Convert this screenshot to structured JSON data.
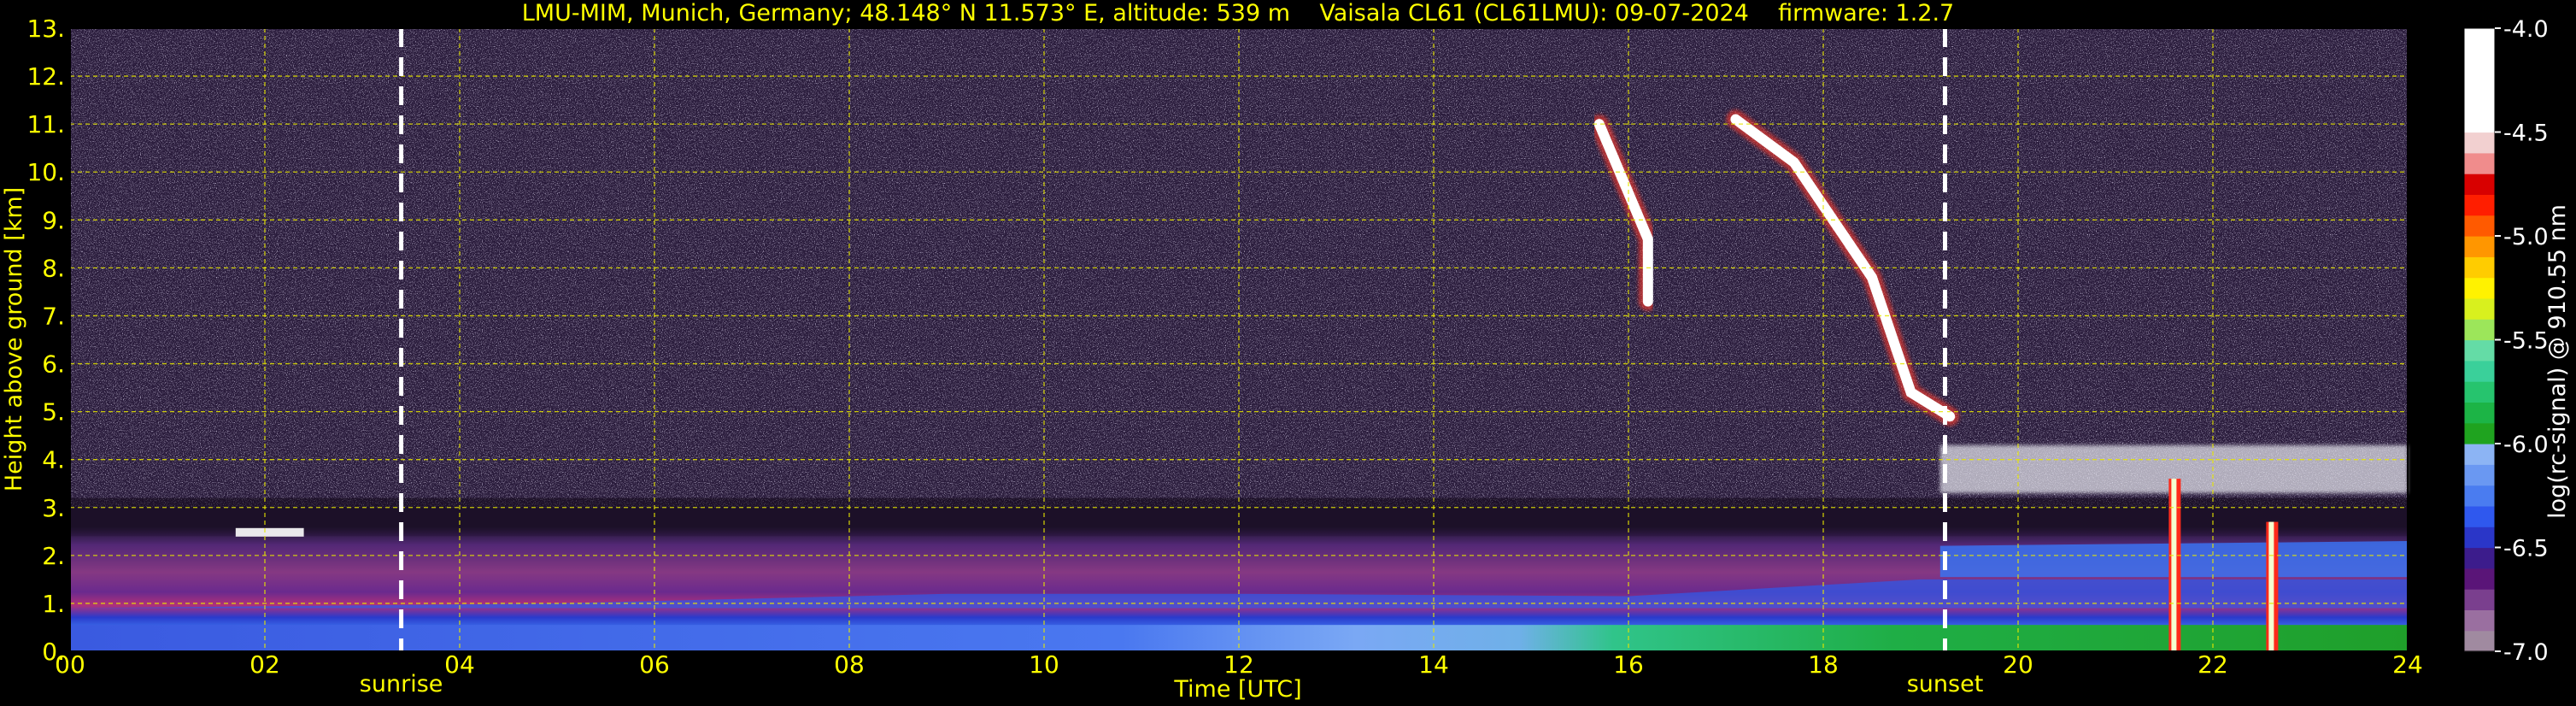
{
  "chart_data": {
    "type": "heatmap",
    "title": "LMU-MIM, Munich, Germany; 48.148° N 11.573° E, altitude: 539 m    Vaisala CL61 (CL61LMU): 09-07-2024    firmware: 1.2.7",
    "xlabel": "Time [UTC]",
    "ylabel": "Height above ground [km]",
    "xlim": [
      0,
      24
    ],
    "ylim": [
      0,
      13
    ],
    "x_ticks": [
      "00",
      "02",
      "04",
      "06",
      "08",
      "10",
      "12",
      "14",
      "16",
      "18",
      "20",
      "22",
      "24"
    ],
    "y_ticks": [
      "0.",
      "1.",
      "2.",
      "3.",
      "4.",
      "5.",
      "6.",
      "7.",
      "8.",
      "9.",
      "10.",
      "11.",
      "12.",
      "13."
    ],
    "grid": true,
    "sun_events": [
      {
        "label": "sunrise",
        "time": 3.4
      },
      {
        "label": "sunset",
        "time": 19.25
      }
    ],
    "colorbar": {
      "label": "log(rc-signal) @ 910.55 nm",
      "range": [
        -7.0,
        -4.0
      ],
      "ticks": [
        "-4.0",
        "-4.5",
        "-5.0",
        "-5.5",
        "-6.0",
        "-6.5",
        "-7.0"
      ],
      "colors": [
        "#a08aa0",
        "#9a6fa0",
        "#7a3f8e",
        "#5a1578",
        "#3c1c8c",
        "#2a36c8",
        "#2f58ee",
        "#4a7cf0",
        "#6a98f2",
        "#8cb4f4",
        "#1fa31f",
        "#1cb446",
        "#26c46e",
        "#3ad09a",
        "#64dca6",
        "#9ce65a",
        "#d8f01e",
        "#fff200",
        "#ffcc00",
        "#ff9600",
        "#ff5a00",
        "#ff1e00",
        "#d80000",
        "#f08c8c",
        "#f2d0d0",
        "#ffffff",
        "#ffffff",
        "#ffffff",
        "#ffffff",
        "#ffffff"
      ]
    },
    "features": [
      {
        "name": "boundary layer aerosol",
        "from": 0,
        "to": 24,
        "top_km": 2.6
      },
      {
        "name": "cirrus fall streak A",
        "points": [
          [
            15.7,
            11.0
          ],
          [
            16.2,
            8.6
          ],
          [
            16.2,
            7.3
          ]
        ]
      },
      {
        "name": "cirrus fall streak B",
        "points": [
          [
            17.1,
            11.1
          ],
          [
            17.7,
            10.2
          ],
          [
            18.5,
            7.8
          ],
          [
            18.9,
            5.4
          ],
          [
            19.3,
            4.9
          ]
        ]
      },
      {
        "name": "mid-level cloud layer",
        "from": 19.2,
        "to": 24,
        "base_km": 3.3,
        "top_km": 4.3
      },
      {
        "name": "precipitation column",
        "time": 21.6,
        "from_km": 0.0,
        "to_km": 3.6
      },
      {
        "name": "precipitation column",
        "time": 22.6,
        "from_km": 0.0,
        "to_km": 2.7
      },
      {
        "name": "low cloud",
        "from": 1.7,
        "to": 2.4,
        "height_km": 2.5
      }
    ]
  }
}
